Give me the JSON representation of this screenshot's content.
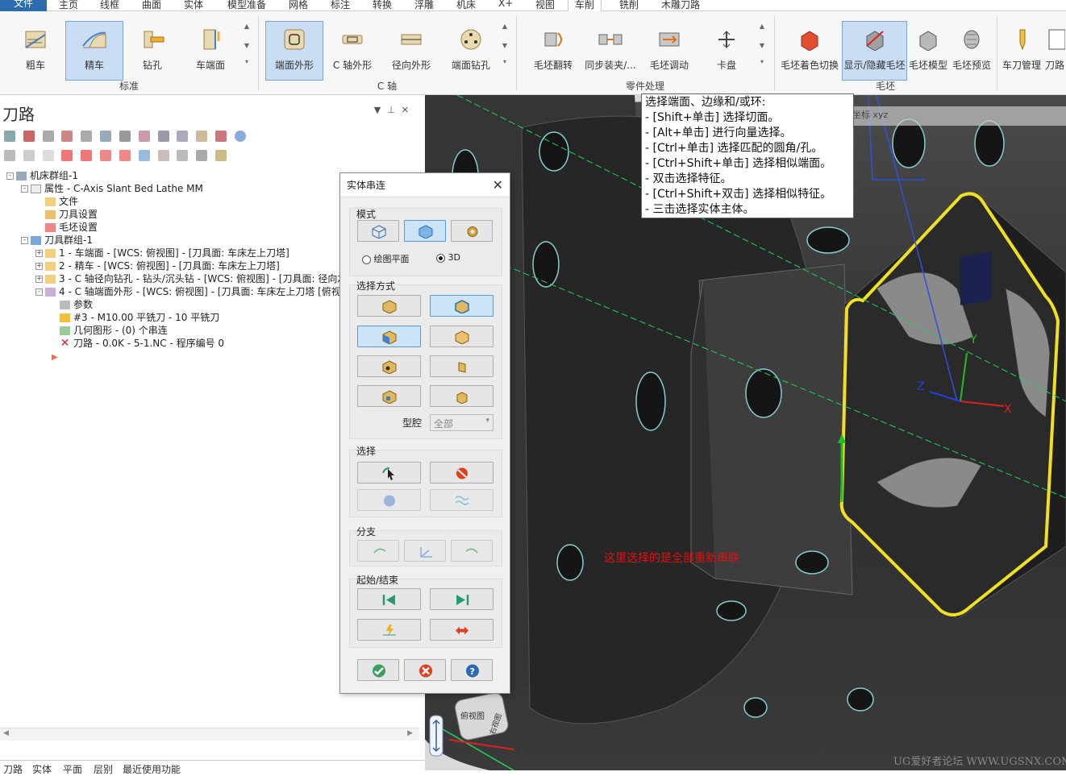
{
  "menu": {
    "tabs": [
      "文件",
      "主页",
      "线框",
      "曲面",
      "实体",
      "模型准备",
      "网格",
      "标注",
      "转换",
      "浮雕",
      "机床",
      "X+",
      "视图",
      "车削",
      "铣削",
      "木雕刀路"
    ],
    "active": "车削"
  },
  "ribbon": {
    "groups": [
      {
        "label": "标准",
        "buttons": [
          "粗车",
          "精车",
          "钻孔",
          "车端面"
        ]
      },
      {
        "label": "C 轴",
        "buttons": [
          "端面外形",
          "C 轴外形",
          "径向外形",
          "端面钻孔"
        ]
      },
      {
        "label": "零件处理",
        "buttons": [
          "毛坯翻转",
          "同步装夹/...",
          "毛坯调动",
          "卡盘"
        ]
      },
      {
        "label": "毛坯",
        "buttons": [
          "毛坯着色切换",
          "显示/隐藏毛坯",
          "毛坯模型",
          "毛坯预览"
        ]
      }
    ],
    "extra_buttons": [
      "车刀管理",
      "刀路"
    ],
    "selected": [
      "精车",
      "端面外形",
      "显示/隐藏毛坯"
    ]
  },
  "panel": {
    "title": "刀路",
    "tree": [
      {
        "level": 0,
        "text": "机床群组-1",
        "icon": "machine-icon",
        "exp": "-"
      },
      {
        "level": 1,
        "text": "属性 - C-Axis Slant Bed Lathe MM",
        "icon": "properties-icon",
        "exp": "-"
      },
      {
        "level": 2,
        "text": "文件",
        "icon": "folder-icon",
        "exp": ""
      },
      {
        "level": 2,
        "text": "刀具设置",
        "icon": "tool-settings-icon",
        "exp": ""
      },
      {
        "level": 2,
        "text": "毛坯设置",
        "icon": "stock-icon",
        "exp": ""
      },
      {
        "level": 1,
        "text": "刀具群组-1",
        "icon": "toolgroup-icon",
        "exp": "-"
      },
      {
        "level": 2,
        "text": "1 - 车端面 - [WCS: 俯视图] - [刀具面: 车床左上刀塔]",
        "icon": "folder-icon",
        "exp": "+"
      },
      {
        "level": 2,
        "text": "2 - 精车 - [WCS: 俯视图] - [刀具面: 车床左上刀塔]",
        "icon": "folder-icon",
        "exp": "+"
      },
      {
        "level": 2,
        "text": "3 - C 轴径向钻孔 - 钻头/沉头钻 - [WCS: 俯视图] - [刀具面: 径向左",
        "icon": "folder-icon",
        "exp": "+"
      },
      {
        "level": 2,
        "text": "4 - C 轴端面外形 - [WCS: 俯视图] - [刀具面: 车床左上刀塔 [俯视图",
        "icon": "op-error-icon",
        "exp": "-"
      },
      {
        "level": 3,
        "text": "参数",
        "icon": "params-icon",
        "exp": ""
      },
      {
        "level": 3,
        "text": "#3 - M10.00 平铣刀 - 10 平铣刀",
        "icon": "endmill-icon",
        "exp": ""
      },
      {
        "level": 3,
        "text": "几何图形 - (0) 个串连",
        "icon": "geometry-icon",
        "exp": ""
      },
      {
        "level": 3,
        "text": "刀路 - 0.0K - 5-1.NC - 程序编号 0",
        "icon": "toolpath-dirty-icon",
        "exp": ""
      }
    ],
    "bottom_tabs": [
      "刀路",
      "实体",
      "平面",
      "层别",
      "最近使用功能"
    ]
  },
  "dialog": {
    "title": "实体串连",
    "mode_label": "模式",
    "radio_plane": "绘图平面",
    "radio_3d": "3D",
    "select_mode_label": "选择方式",
    "cavity_label": "型腔",
    "cavity_value": "全部",
    "select_label": "选择",
    "branch_label": "分支",
    "startend_label": "起始/结束"
  },
  "tooltip": {
    "lines": [
      "选择端面、边缘和/或环:",
      "- [Shift+单击] 选择切面。",
      "- [Alt+单击] 进行向量选择。",
      "- [Ctrl+单击] 选择匹配的圆角/孔。",
      "- [Ctrl+Shift+单击] 选择相似端面。",
      "- 双击选择特征。",
      "- [Ctrl+Shift+双击] 选择相似特征。",
      "- 三击选择实体主体。"
    ]
  },
  "viewport": {
    "annotation": "这里选择的是全部重新串联",
    "axis_x": "X",
    "axis_y": "Y",
    "axis_z": "Z",
    "cube_front": "俯视图",
    "cube_right": "右视图",
    "watermark": "UG爱好者论坛 WWW.UGSNX.COM",
    "mini_labels": "坐标 xyz"
  },
  "colors": {
    "accent": "#2b6cb0",
    "selected": "#c9def5",
    "highlight_edge": "#f0e020",
    "annotation": "#e01010"
  }
}
